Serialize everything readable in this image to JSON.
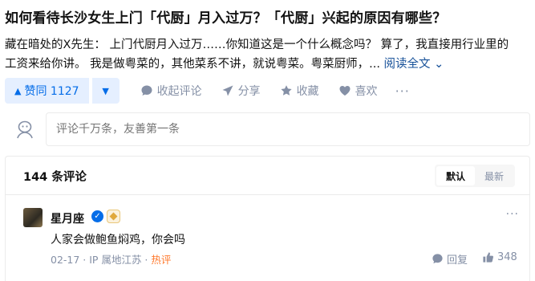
{
  "question": {
    "title": "如何看待长沙女生上门「代厨」月入过万？「代厨」兴起的原因有哪些？"
  },
  "answer": {
    "author": "藏在暗处的X先生：",
    "excerpt_line1": "上门代厨月入过万……你知道这是一个什么概念吗？ 算了，我直接用行业里的",
    "excerpt_line2": "工资来给你讲。 我是做粤菜的，其他菜系不讲，就说粤菜。粤菜厨师，...",
    "read_more": "阅读全文",
    "read_more_arrow": "⌄"
  },
  "actions": {
    "vote_up": "赞同 1127",
    "vote_down": "▼",
    "collapse_comments": "收起评论",
    "share": "分享",
    "favorite": "收藏",
    "like": "喜欢",
    "more": "···"
  },
  "comment_input": {
    "placeholder": "评论千万条，友善第一条"
  },
  "comments": {
    "count_label": "144 条评论",
    "sort_default": "默认",
    "sort_latest": "最新",
    "items": [
      {
        "name": "星月座",
        "text": "人家会做鲍鱼焖鸡，你会吗",
        "date": "02-17",
        "location": "IP 属地江苏",
        "tag": "热评",
        "reply": "回复",
        "likes": "348",
        "more": "···"
      }
    ]
  },
  "colors": {
    "accent": "#056de8",
    "muted": "#8590a6",
    "hot": "#ff7a2e"
  }
}
